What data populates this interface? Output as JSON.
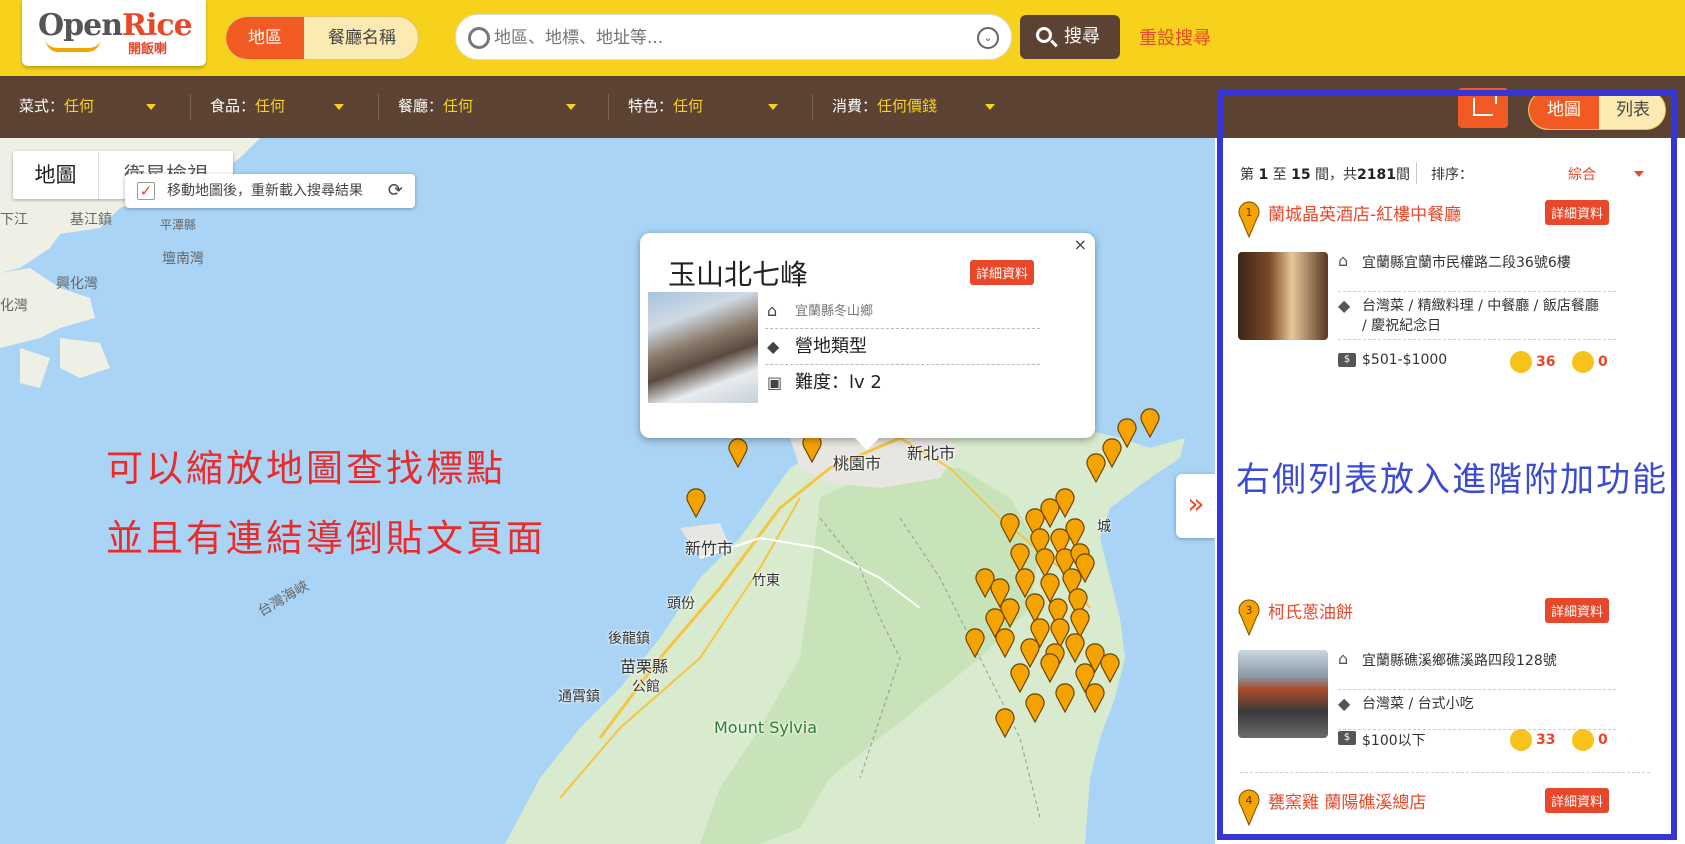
{
  "header": {
    "logo_text_a": "Open",
    "logo_text_b": "Rice",
    "logo_sub": "開飯喇",
    "seg_active": "地區",
    "seg_inactive": "餐廳名稱",
    "search_placeholder": "地區、地標、地址等...",
    "search_button": "搜尋",
    "reset_link": "重設搜尋"
  },
  "filters": [
    {
      "label": "菜式：",
      "value": "任何"
    },
    {
      "label": "食品：",
      "value": "任何"
    },
    {
      "label": "餐廳：",
      "value": "任何"
    },
    {
      "label": "特色：",
      "value": "任何"
    },
    {
      "label": "消費：",
      "value": "任何價錢"
    }
  ],
  "map": {
    "toggle_map": "地圖",
    "toggle_satellite": "衛星檢視",
    "reload_text": "移動地圖後，重新載入搜尋結果",
    "labels": {
      "xiajiang": "下江",
      "jiangying": "基江鎮",
      "pingtan": "平潭縣",
      "tannan": "壇南灣",
      "xinghua": "興化灣",
      "huawan": "化灣",
      "strait": "台灣海峽",
      "taoyuan": "桃園市",
      "xinbei": "新北市",
      "hsinchu": "新竹市",
      "zhudong": "竹東",
      "toufen": "頭份",
      "houlong": "後龍鎮",
      "miaoli": "苗栗縣",
      "gongguan": "公館",
      "tongxiao": "通霄鎮",
      "mount": "Mount Sylvia",
      "xin": "新",
      "cheng": "城"
    },
    "popup": {
      "title": "玉山北七峰",
      "detail_btn": "詳細資料",
      "address": "宜蘭縣冬山鄉",
      "type": "營地類型",
      "difficulty": "難度：lv 2",
      "close": "×"
    },
    "note_line1": "可以縮放地圖查找標點",
    "note_line2": "並且有連結導倒貼文頁面",
    "expand": "»"
  },
  "panel": {
    "view_map": "地圖",
    "view_list": "列表",
    "summary_a": "第",
    "summary_from": "1",
    "summary_b": "至",
    "summary_to": "15",
    "summary_c": "間，共",
    "summary_total": "2181",
    "summary_d": "間",
    "sort_label": "排序：",
    "sort_value": "綜合",
    "note": "右側列表放入進階附加功能",
    "items": [
      {
        "num": "1",
        "name": "蘭城晶英酒店-紅樓中餐廳",
        "detail_btn": "詳細資料",
        "address": "宜蘭縣宜蘭市民權路二段36號6樓",
        "tags": "台灣菜 / 精緻料理 / 中餐廳 / 飯店餐廳",
        "tags2": "/ 慶祝紀念日",
        "price": "$501-$1000",
        "smile": "36",
        "sad": "0"
      },
      {
        "num": "3",
        "name": "柯氏蔥油餅",
        "detail_btn": "詳細資料",
        "address": "宜蘭縣礁溪鄉礁溪路四段128號",
        "tags": "台灣菜 / 台式小吃",
        "price": "$100以下",
        "smile": "33",
        "sad": "0"
      },
      {
        "num": "4",
        "name": "甕窯雞 蘭陽礁溪總店",
        "detail_btn": "詳細資料"
      }
    ]
  },
  "colors": {
    "brand_yellow": "#f7d21c",
    "brand_orange": "#f15a22",
    "brand_brown": "#5b4233",
    "accent_red": "#e8472a",
    "outline_blue": "#3535d8"
  }
}
